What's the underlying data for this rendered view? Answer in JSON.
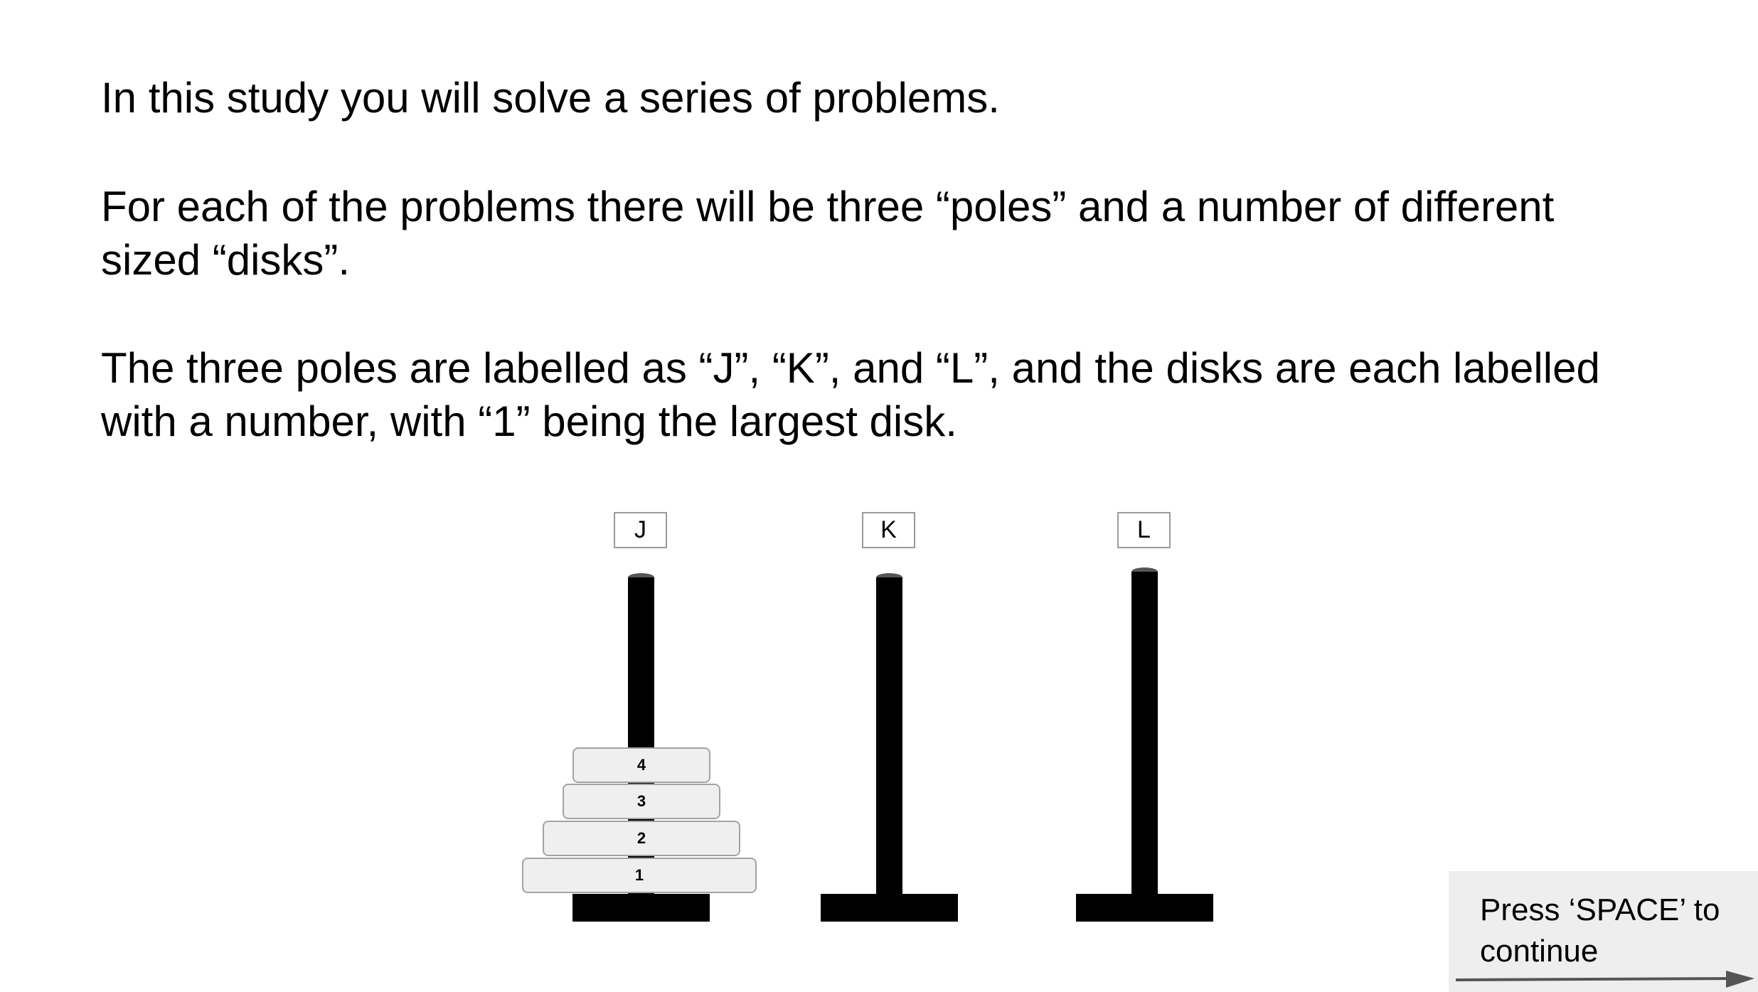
{
  "instructions": {
    "para1": "In this study you will solve a series of problems.",
    "para2_line1": "For each of the problems there will be three “poles” and a number of different",
    "para2_line2": "sized “disks”.",
    "para3_line1": "The three poles are labelled as “J”, “K”, and “L”, and the disks are each labelled",
    "para3_line2": "with a number, with “1” being the largest disk."
  },
  "poles": [
    {
      "label": "J"
    },
    {
      "label": "K"
    },
    {
      "label": "L"
    }
  ],
  "disks": [
    {
      "label": "4"
    },
    {
      "label": "3"
    },
    {
      "label": "2"
    },
    {
      "label": "1"
    }
  ],
  "continue": {
    "text": "Press ‘SPACE’ to continue",
    "icon": "arrow-right-icon"
  },
  "colors": {
    "rod": "#000000",
    "disk_fill": "#efefef",
    "disk_border": "#a3a3a3",
    "continue_bg": "#eeeeee"
  }
}
